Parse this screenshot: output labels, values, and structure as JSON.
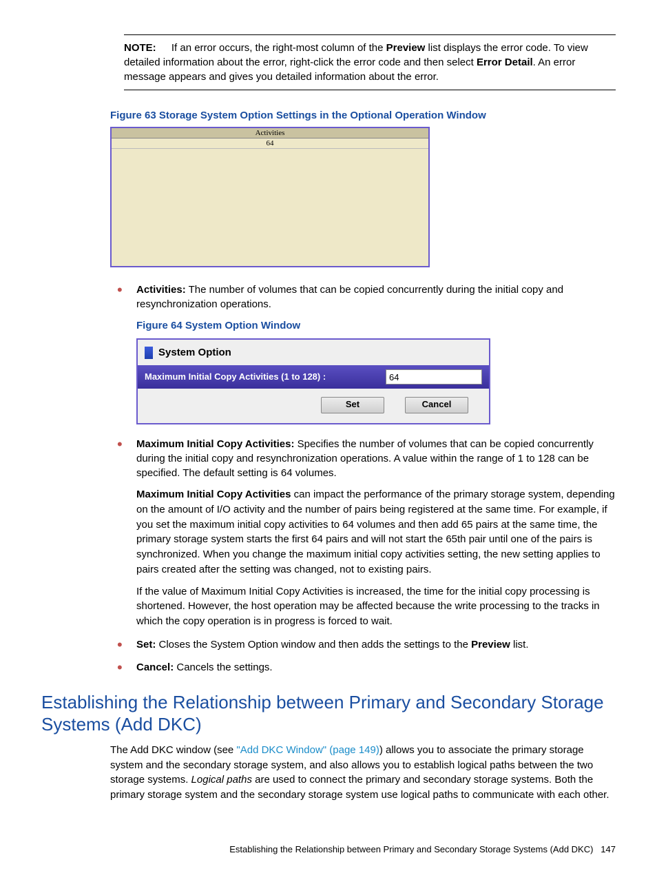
{
  "note": {
    "label": "NOTE:",
    "t1": "If an error occurs, the right-most column of the ",
    "preview": "Preview",
    "t2": " list displays the error code. To view detailed information about the error, right-click the error code and then select ",
    "error_detail": "Error Detail",
    "t3": ". An error message appears and gives you detailed information about the error."
  },
  "fig63": {
    "caption": "Figure 63 Storage System Option Settings in the Optional Operation Window",
    "header": "Activities",
    "value": "64"
  },
  "activities": {
    "label": "Activities:",
    "text": " The number of volumes that can be copied concurrently during the initial copy and resynchronization operations."
  },
  "fig64": {
    "caption": "Figure 64 System Option Window",
    "title": "System Option",
    "field_label": "Maximum Initial Copy Activities (1 to 128) :",
    "field_value": "64",
    "set": "Set",
    "cancel": "Cancel"
  },
  "mica": {
    "label": "Maximum Initial Copy Activities:",
    "p1": " Specifies the number of volumes that can be copied concurrently during the initial copy and resynchronization operations. A value within the range of 1 to 128 can be specified. The default setting is 64 volumes.",
    "p2a": "Maximum Initial Copy Activities",
    "p2b": " can impact the performance of the primary storage system, depending on the amount of I/O activity and the number of pairs being registered at the same time. For example, if you set the maximum initial copy activities to 64 volumes and then add 65 pairs at the same time, the primary storage system starts the first 64 pairs and will not start the 65th pair until one of the pairs is synchronized. When you change the maximum initial copy activities setting, the new setting applies to pairs created after the setting was changed, not to existing pairs.",
    "p3": "If the value of Maximum Initial Copy Activities is increased, the time for the initial copy processing is shortened. However, the host operation may be affected because the write processing to the tracks in which the copy operation is in progress is forced to wait."
  },
  "set": {
    "label": "Set:",
    "t1": " Closes the System Option window and then adds the settings to the ",
    "preview": "Preview",
    "t2": " list."
  },
  "cancel": {
    "label": "Cancel:",
    "text": " Cancels the settings."
  },
  "h2": "Establishing the Relationship between Primary and Secondary Storage Systems (Add DKC)",
  "section": {
    "t1": "The Add DKC window (see ",
    "link": "\"Add DKC Window\" (page 149)",
    "t2": ") allows you to associate the primary storage system and the secondary storage system, and also allows you to establish logical paths between the two storage systems. ",
    "logical": "Logical paths",
    "t3": " are used to connect the primary and secondary storage systems. Both the primary storage system and the secondary storage system use logical paths to communicate with each other."
  },
  "footer": {
    "text": "Establishing the Relationship between Primary and Secondary Storage Systems (Add DKC)",
    "page": "147"
  }
}
